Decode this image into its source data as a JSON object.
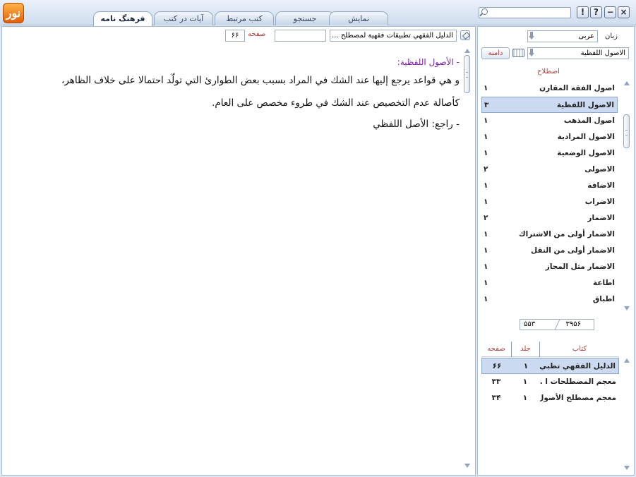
{
  "titlebar": {
    "logo_text": "نور",
    "search_placeholder": "",
    "buttons": {
      "info": "!",
      "help": "?",
      "minimize": "−",
      "close": "×"
    }
  },
  "tabs": [
    {
      "label": "فرهنگ نامه",
      "active": true
    },
    {
      "label": "آیات در کتب",
      "active": false
    },
    {
      "label": "کتب مرتبط",
      "active": false
    },
    {
      "label": "جستجو",
      "active": false
    },
    {
      "label": "نمایش",
      "active": false
    }
  ],
  "content": {
    "book_field": "الدليل الفقهي تطبيقات فقهية لمصطلح ...",
    "goto_page": "",
    "page_label": "صفحه",
    "page_number": "۶۶",
    "heading": "- الأصول اللفظية:",
    "lines": [
      "و هي قواعد يرجع إليها عند الشك في المراد بسبب بعض الطوارئ التي تولّد احتمالا على خلاف الظاهر،",
      "كأصالة عدم التخصيص عند الشك في طروء مخصص على العام."
    ],
    "reference": "- راجع: الأصل اللفظي"
  },
  "dictionary": {
    "lang_label": "زبان",
    "lang_value": "عربی",
    "term_value": "الاصول اللفظية",
    "domain_button": "دامنه",
    "terms_header": "اصطلاح",
    "terms": [
      {
        "name": "اصول الفقه المقارن",
        "count": "۱"
      },
      {
        "name": "الاصول اللفظية",
        "count": "۳",
        "selected": true
      },
      {
        "name": "اصول المذهب",
        "count": "۱"
      },
      {
        "name": "الاصول المرادية",
        "count": "۱"
      },
      {
        "name": "الاصول الوضعية",
        "count": "۱"
      },
      {
        "name": "الاصولی",
        "count": "۲"
      },
      {
        "name": "الاضافة",
        "count": "۱"
      },
      {
        "name": "الاضراب",
        "count": "۱"
      },
      {
        "name": "الاضمار",
        "count": "۲"
      },
      {
        "name": "الاضمار أولی من الاشتراك",
        "count": "۱"
      },
      {
        "name": "الاضمار أولی من النقل",
        "count": "۱"
      },
      {
        "name": "الاضمار مثل المجاز",
        "count": "۱"
      },
      {
        "name": "اطاعة",
        "count": "۱"
      },
      {
        "name": "اطباق",
        "count": "۱"
      }
    ],
    "counter": {
      "total": "۳۹۵۶",
      "found": "۵۵۳"
    },
    "books_header": {
      "book": "کتاب",
      "volume": "جلد",
      "page": "صفحه"
    },
    "books": [
      {
        "name": "الدليل الفقهي تطبي ...",
        "volume": "۱",
        "page": "۶۶",
        "selected": true
      },
      {
        "name": "معجم المصطلحات ا ...",
        "volume": "۱",
        "page": "۳۳"
      },
      {
        "name": "معجم مصطلح الأصول",
        "volume": "۱",
        "page": "۳۴"
      }
    ]
  }
}
